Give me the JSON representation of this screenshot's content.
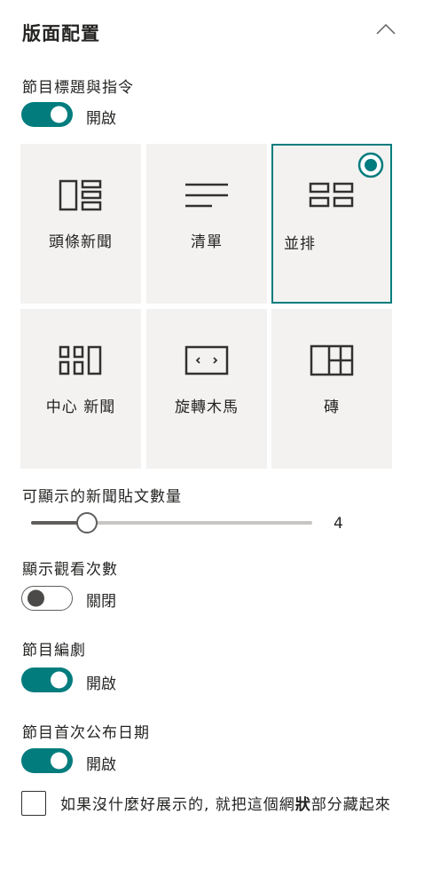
{
  "section": {
    "title": "版面配置"
  },
  "title_commands": {
    "label": "節目標題與指令",
    "toggle_text": "開啟",
    "enabled": true
  },
  "layouts": [
    {
      "label": "頭條新聞",
      "icon": "top-story-layout-icon",
      "selected": false
    },
    {
      "label": "清單",
      "icon": "list-layout-icon",
      "selected": false
    },
    {
      "label": "並排",
      "icon": "side-by-side-layout-icon",
      "selected": true
    },
    {
      "label": "中心 新聞",
      "icon": "hub-news-layout-icon",
      "selected": false
    },
    {
      "label": "旋轉木馬",
      "icon": "carousel-layout-icon",
      "selected": false
    },
    {
      "label": "磚",
      "icon": "tiles-layout-icon",
      "selected": false
    }
  ],
  "post_count": {
    "label": "可顯示的新聞貼文數量",
    "value": "4"
  },
  "view_counts": {
    "label": "顯示觀看次數",
    "toggle_text": "關閉",
    "enabled": false
  },
  "author": {
    "label": "節目編劇",
    "toggle_text": "開啟",
    "enabled": true
  },
  "publish_date": {
    "label": "節目首次公布日期",
    "toggle_text": "開啟",
    "enabled": true
  },
  "hide_section": {
    "label_prefix": "如果沒什麼好展示的, 就把這個網",
    "label_bold": "狀",
    "label_suffix": "部分藏起來",
    "checked": false
  },
  "colors": {
    "accent": "#037c7e",
    "tile_bg": "#f3f2f1",
    "text": "#252423"
  }
}
